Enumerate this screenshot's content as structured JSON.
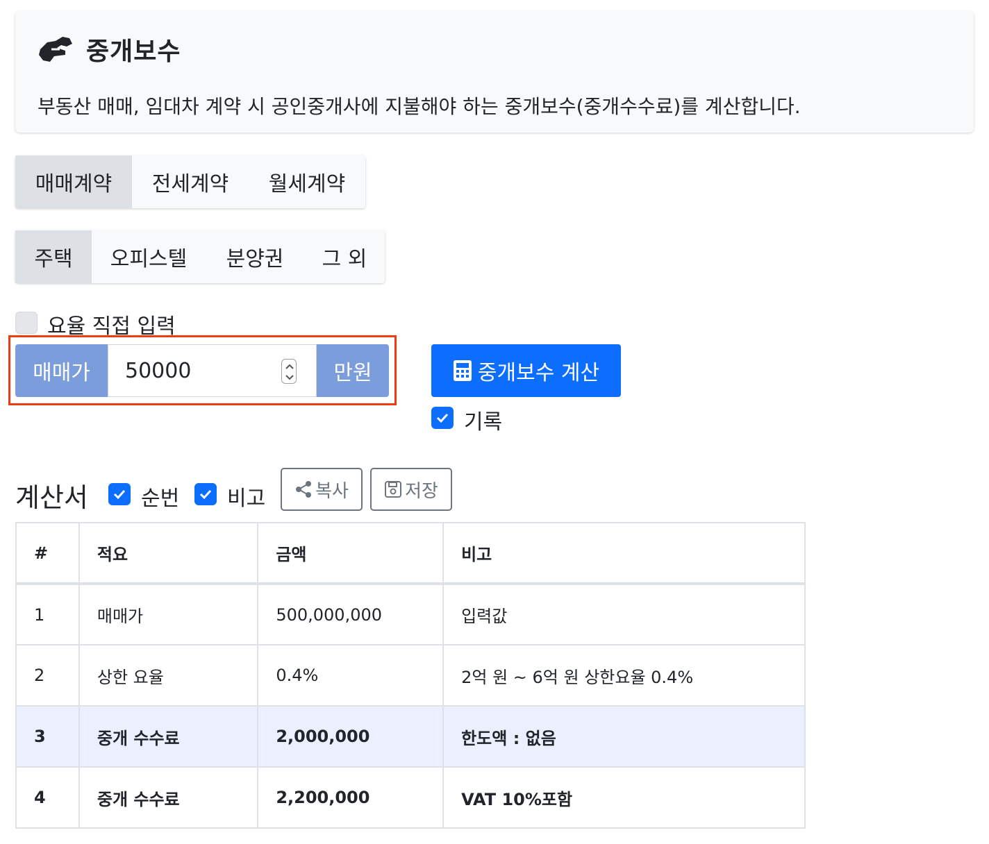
{
  "header": {
    "icon": "handshake-icon",
    "title": "중개보수",
    "description": "부동산 매매, 임대차 계약 시 공인중개사에 지불해야 하는 중개보수(중개수수료)를 계산합니다."
  },
  "contract_tabs": [
    {
      "label": "매매계약",
      "active": true
    },
    {
      "label": "전세계약",
      "active": false
    },
    {
      "label": "월세계약",
      "active": false
    }
  ],
  "property_tabs": [
    {
      "label": "주택",
      "active": true
    },
    {
      "label": "오피스텔",
      "active": false
    },
    {
      "label": "분양권",
      "active": false
    },
    {
      "label": "그 외",
      "active": false
    }
  ],
  "manual_rate": {
    "label": "요율 직접 입력",
    "checked": false
  },
  "price_input": {
    "prefix": "매매가",
    "value": "50000",
    "suffix": "만원"
  },
  "calculate_button": {
    "label": "중개보수 계산",
    "icon": "calculator-icon"
  },
  "record": {
    "label": "기록",
    "checked": true
  },
  "statement": {
    "title": "계산서",
    "show_number": {
      "label": "순번",
      "checked": true
    },
    "show_note": {
      "label": "비고",
      "checked": true
    },
    "copy_button": {
      "label": "복사",
      "icon": "share-icon"
    },
    "save_button": {
      "label": "저장",
      "icon": "floppy-disk-icon"
    }
  },
  "table": {
    "headers": [
      "#",
      "적요",
      "금액",
      "비고"
    ],
    "rows": [
      [
        "1",
        "매매가",
        "500,000,000",
        "입력값"
      ],
      [
        "2",
        "상한 요율",
        "0.4%",
        "2억 원 ~ 6억 원 상한요율 0.4%"
      ],
      [
        "3",
        "중개 수수료",
        "2,000,000",
        "한도액 : 없음"
      ],
      [
        "4",
        "중개 수수료",
        "2,200,000",
        "VAT 10%포함"
      ]
    ]
  },
  "colors": {
    "primary": "#0d6efd",
    "addon": "#7b9ddc",
    "highlight_border": "#ef3b12",
    "highlight_row": "#ebefff"
  }
}
